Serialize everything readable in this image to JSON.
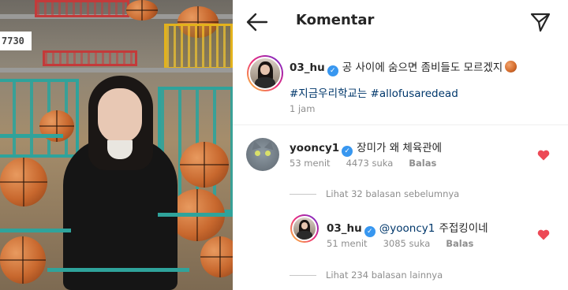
{
  "header": {
    "title": "Komentar"
  },
  "post": {
    "username": "03_hu",
    "caption": "공 사이에 숨으면 좀비들도 모르겠지",
    "hashtags": "#지금우리학교는 #allofusaredead",
    "time": "1 jam"
  },
  "comments": [
    {
      "username": "yooncy1",
      "text": "장미가 왜 체육관에",
      "time": "53 menit",
      "likes": "4473 suka",
      "reply_label": "Balas",
      "view_prev": "Lihat 32 balasan sebelumnya"
    }
  ],
  "reply": {
    "username": "03_hu",
    "mention": "@yooncy1",
    "text": "주접킹이네",
    "time": "51 menit",
    "likes": "3085 suka",
    "reply_label": "Balas",
    "view_more": "Lihat 234 balasan lainnya"
  },
  "photo": {
    "scoreboard_digits": "7730"
  },
  "colors": {
    "verified": "#3897f0",
    "heart": "#ed4956",
    "hashtag": "#00376b",
    "meta": "#8e8e8e"
  },
  "icons": [
    "back-arrow-icon",
    "send-icon",
    "verified-badge-icon",
    "basketball-emoji-icon",
    "heart-icon"
  ]
}
